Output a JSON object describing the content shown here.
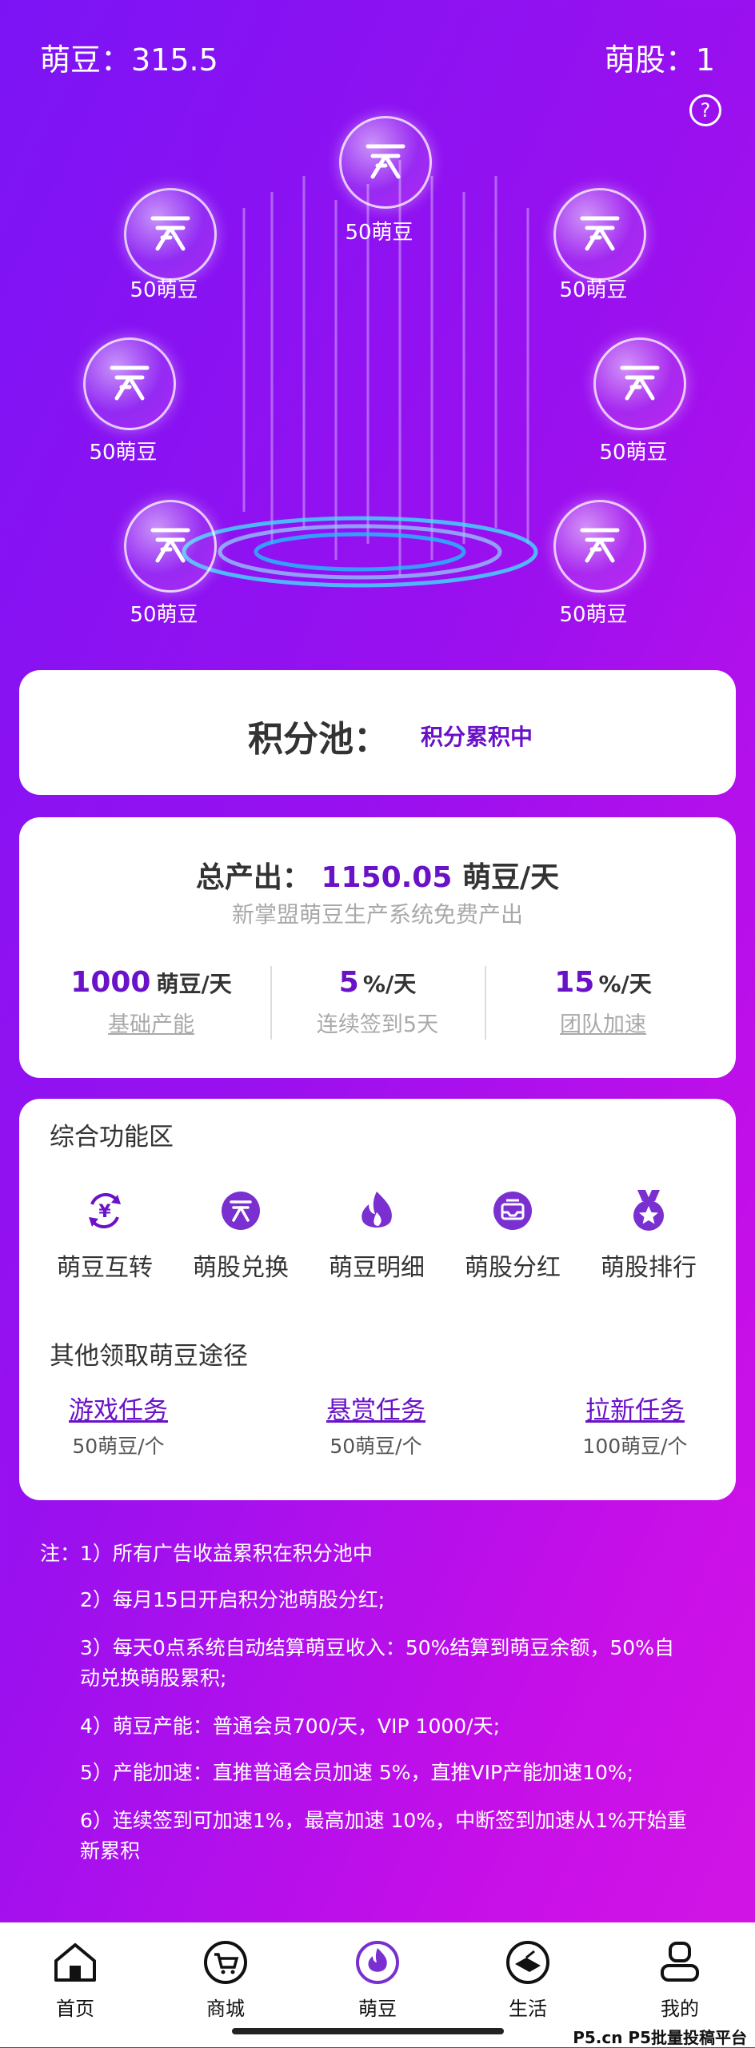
{
  "header": {
    "beans_label": "萌豆：315.5",
    "shares_label": "萌股：1",
    "help_icon": "?"
  },
  "bubbles": [
    {
      "label": "50萌豆"
    },
    {
      "label": "50萌豆"
    },
    {
      "label": "50萌豆"
    },
    {
      "label": "50萌豆"
    },
    {
      "label": "50萌豆"
    },
    {
      "label": "50萌豆"
    },
    {
      "label": "50萌豆"
    }
  ],
  "pool": {
    "title": "积分池：",
    "status": "积分累积中"
  },
  "output": {
    "total_label": "总产出：",
    "total_value": "1150.05",
    "total_unit": "萌豆/天",
    "subtitle": "新掌盟萌豆生产系统免费产出",
    "stats": [
      {
        "value": "1000",
        "unit": "萌豆/天",
        "label": "基础产能"
      },
      {
        "value": "5",
        "unit": "%/天",
        "label": "连续签到5天"
      },
      {
        "value": "15",
        "unit": "%/天",
        "label": "团队加速"
      }
    ]
  },
  "functions": {
    "title": "综合功能区",
    "items": [
      {
        "label": "萌豆互转",
        "icon": "yen-transfer-icon"
      },
      {
        "label": "萌股兑换",
        "icon": "coin-exchange-icon"
      },
      {
        "label": "萌豆明细",
        "icon": "flame-icon"
      },
      {
        "label": "萌股分红",
        "icon": "inbox-icon"
      },
      {
        "label": "萌股排行",
        "icon": "medal-icon"
      }
    ],
    "ways_title": "其他领取萌豆途径",
    "ways": [
      {
        "title": "游戏任务",
        "reward": "50萌豆/个"
      },
      {
        "title": "悬赏任务",
        "reward": "50萌豆/个"
      },
      {
        "title": "拉新任务",
        "reward": "100萌豆/个"
      }
    ]
  },
  "notes": {
    "n1": "注：1）所有广告收益累积在积分池中",
    "n2": "2）每月15日开启积分池萌股分红;",
    "n3a": "3）每天0点系统自动结算萌豆收入：50%结算到萌豆余额，50%自",
    "n3b": "动兑换萌股累积;",
    "n4": "4）萌豆产能：普通会员700/天，VIP 1000/天;",
    "n5": "5）产能加速：直推普通会员加速 5%，直推VIP产能加速10%;",
    "n6a": "6）连续签到可加速1%，最高加速 10%，中断签到加速从1%开始重",
    "n6b": "新累积"
  },
  "nav": [
    {
      "label": "首页",
      "icon": "home-icon"
    },
    {
      "label": "商城",
      "icon": "cart-icon"
    },
    {
      "label": "萌豆",
      "icon": "flame-icon"
    },
    {
      "label": "生活",
      "icon": "life-icon"
    },
    {
      "label": "我的",
      "icon": "profile-icon"
    }
  ],
  "watermark": "P5.cn P5批量投稿平台",
  "colors": {
    "accent": "#6a12c8",
    "bg_start": "#7b14f5",
    "bg_end": "#d316e4"
  }
}
